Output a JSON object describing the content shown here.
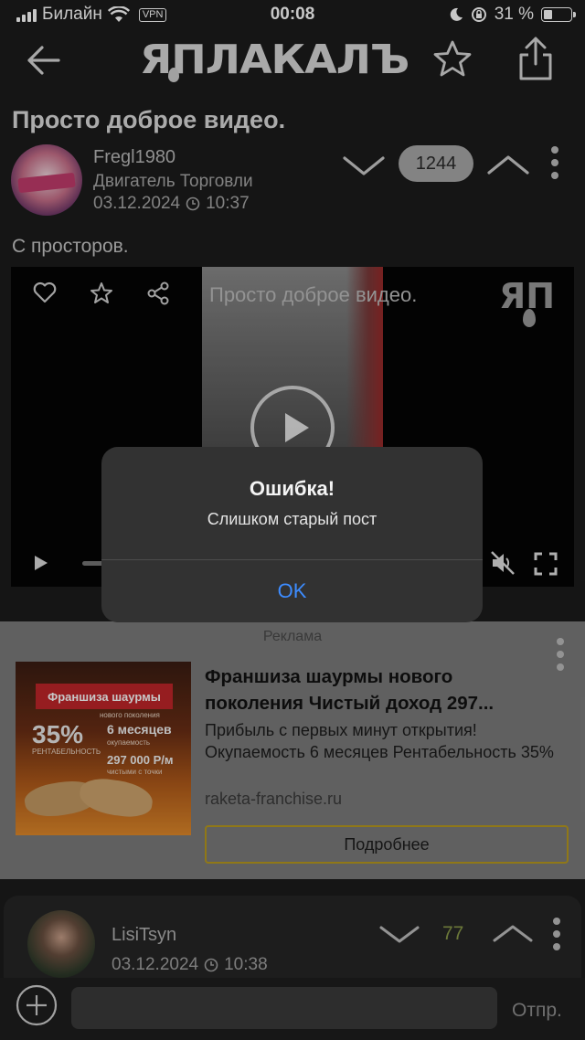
{
  "status_bar": {
    "carrier": "Билайн",
    "vpn": "VPN",
    "time": "00:08",
    "battery_text": "31 %",
    "battery_level": 0.31
  },
  "nav": {
    "logo_text": "ЯПЛАКАЛЪ"
  },
  "post": {
    "title": "Просто доброе видео.",
    "author": "Fregl1980",
    "rank": "Двигатель Торговли",
    "date": "03.12.2024",
    "time": "10:37",
    "rating": "1244",
    "text": "С просторов."
  },
  "video": {
    "title": "Просто доброе видео.",
    "watermark": "ЯП"
  },
  "alert": {
    "title": "Ошибка!",
    "message": "Слишком старый пост",
    "ok_label": "OK"
  },
  "ad": {
    "label": "Реклама",
    "image": {
      "banner": "Франшиза шаурмы",
      "subtitle": "нового поколения",
      "percent": "35%",
      "percent_caption": "РЕНТАБЕЛЬНОСТЬ",
      "months": "6 месяцев",
      "months_caption": "окупаемость",
      "money": "297 000 Р/м",
      "money_caption": "чистыми с точки"
    },
    "headline": "Франшиза шаурмы нового поколения Чистый доход 297...",
    "description": "Прибыль с первых минут открытия! Окупаемость 6 месяцев Рентабельность 35%",
    "domain": "raketa-franchise.ru",
    "cta_label": "Подробнее"
  },
  "comment": {
    "author": "LisiTsyn",
    "date": "03.12.2024",
    "time": "10:38",
    "rating": "77"
  },
  "reply_bar": {
    "send_label": "Отпр."
  }
}
